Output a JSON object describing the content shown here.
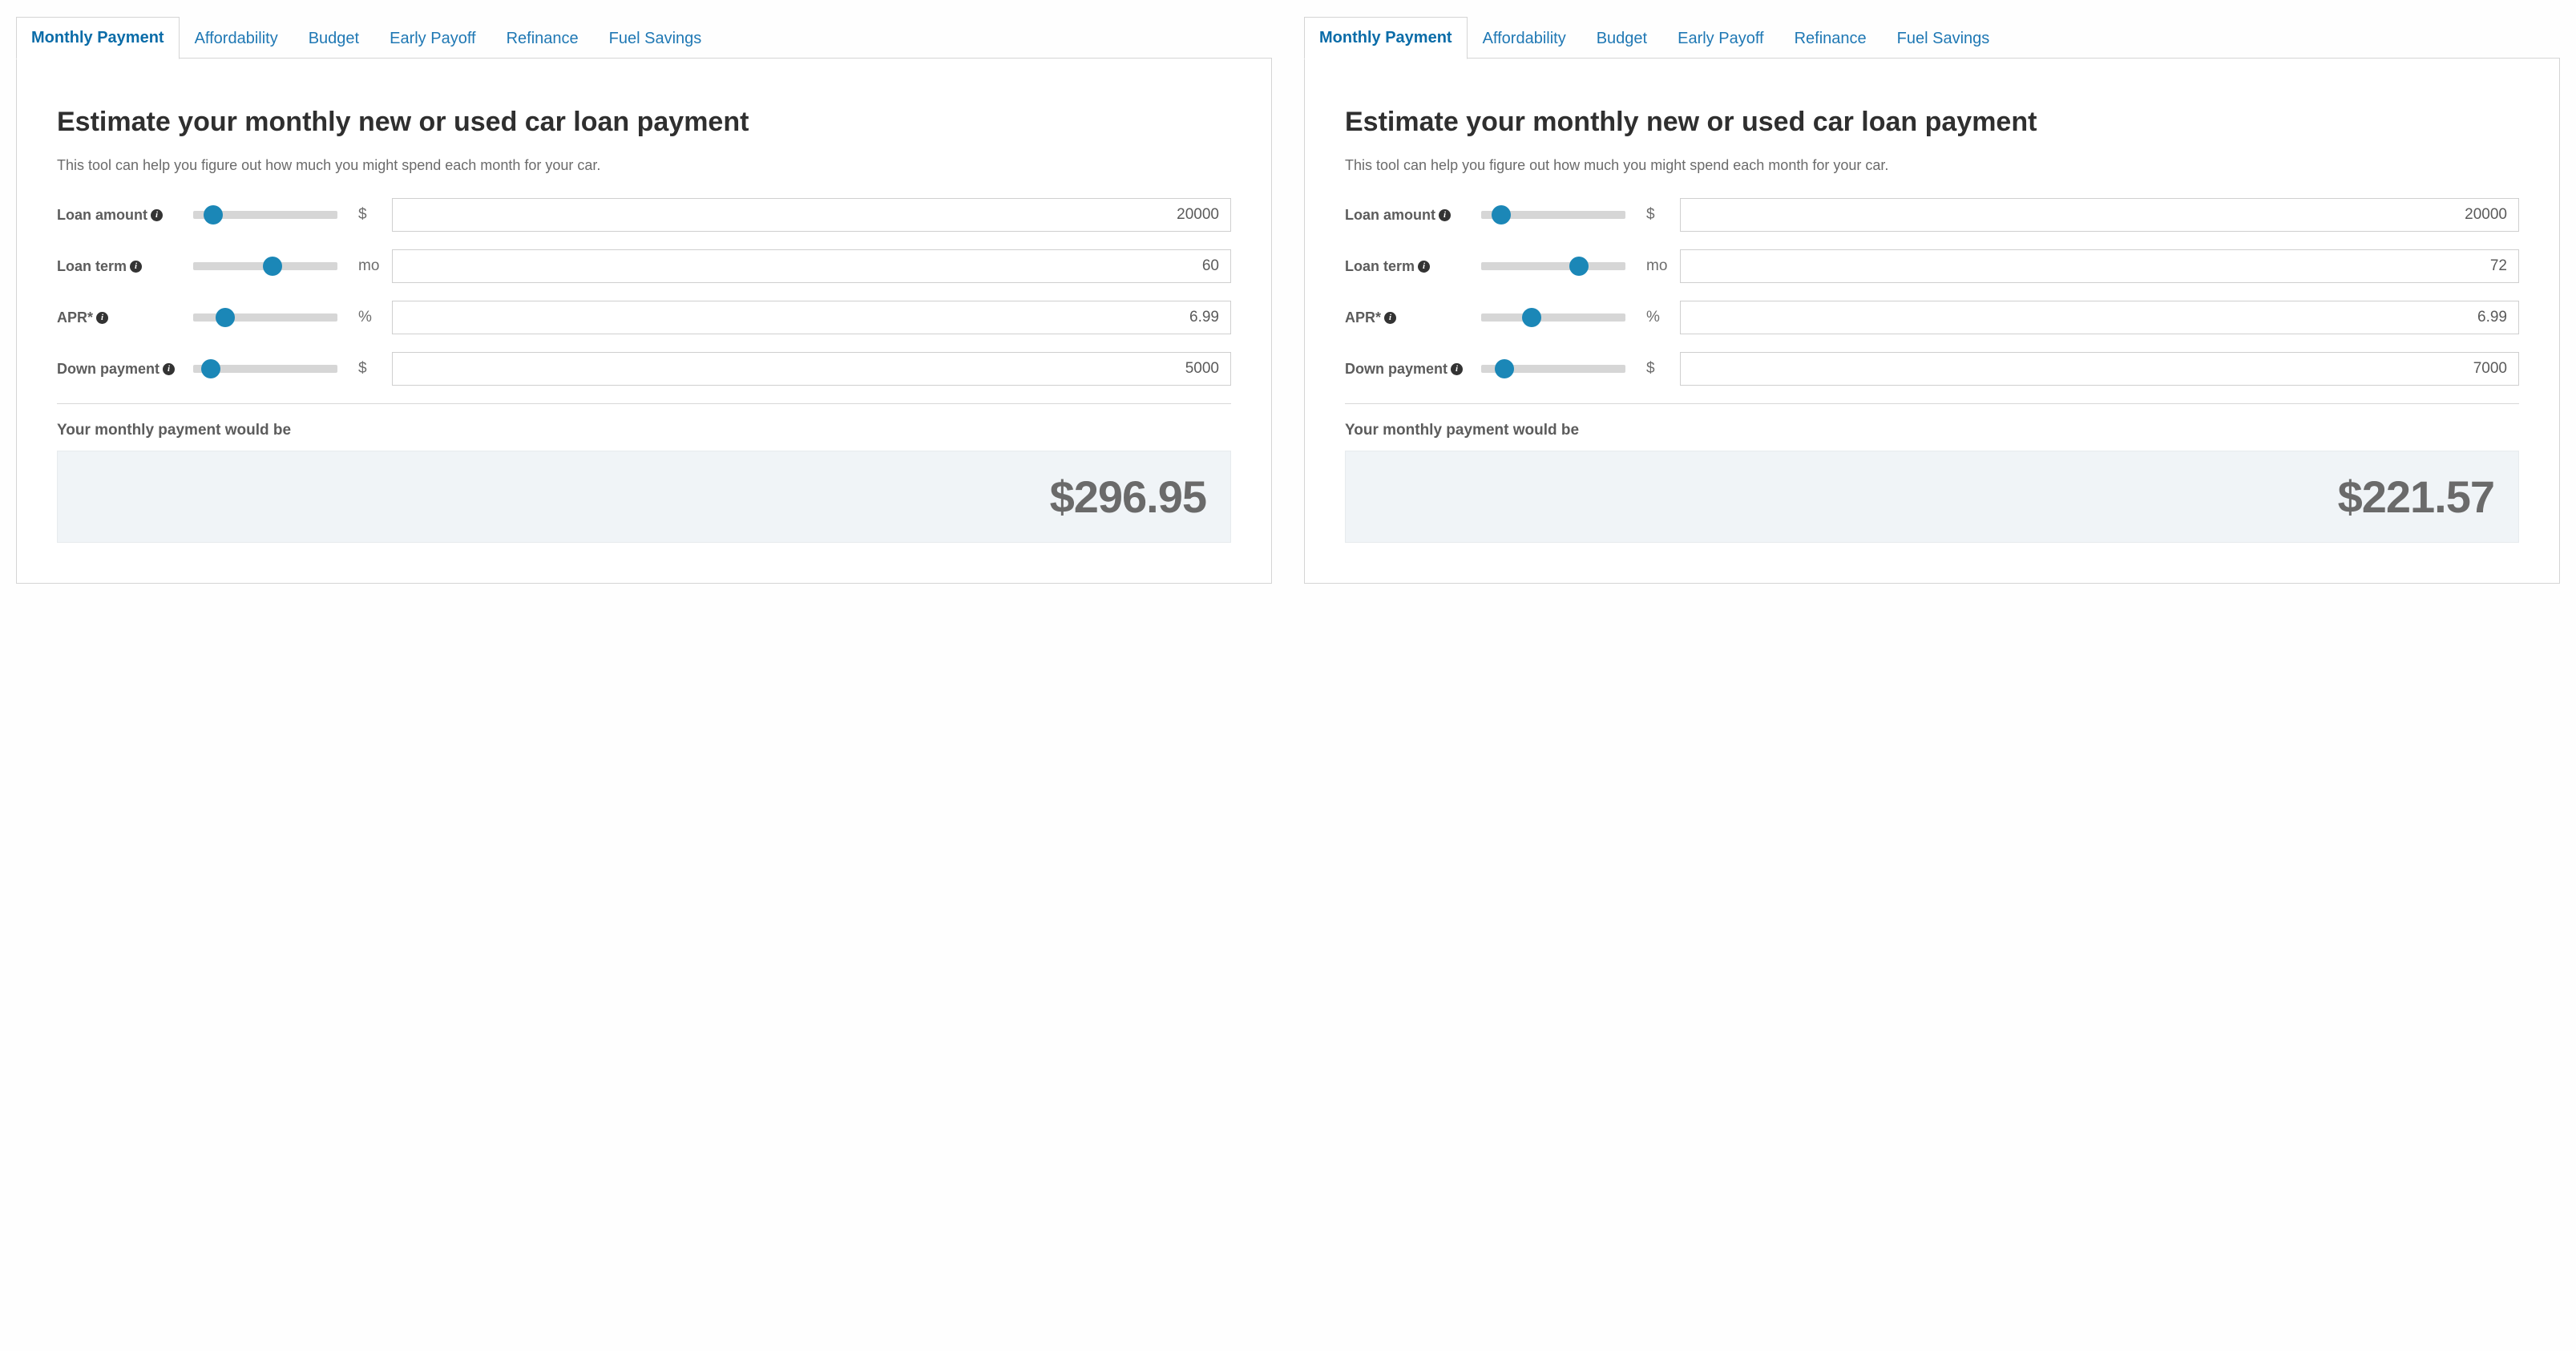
{
  "panels": [
    {
      "tabs": [
        {
          "label": "Monthly Payment",
          "active": true
        },
        {
          "label": "Affordability",
          "active": false
        },
        {
          "label": "Budget",
          "active": false
        },
        {
          "label": "Early Payoff",
          "active": false
        },
        {
          "label": "Refinance",
          "active": false
        },
        {
          "label": "Fuel Savings",
          "active": false
        }
      ],
      "heading": "Estimate your monthly new or used car loan payment",
      "subheading": "This tool can help you figure out how much you might spend each month for your car.",
      "rows": [
        {
          "label": "Loan amount",
          "unit": "$",
          "value": "20000",
          "slider_pct": 14
        },
        {
          "label": "Loan term",
          "unit": "mo",
          "value": "60",
          "slider_pct": 55
        },
        {
          "label": "APR*",
          "unit": "%",
          "value": "6.99",
          "slider_pct": 22
        },
        {
          "label": "Down payment",
          "unit": "$",
          "value": "5000",
          "slider_pct": 12
        }
      ],
      "result_label": "Your monthly payment would be",
      "result_value": "$296.95"
    },
    {
      "tabs": [
        {
          "label": "Monthly Payment",
          "active": true
        },
        {
          "label": "Affordability",
          "active": false
        },
        {
          "label": "Budget",
          "active": false
        },
        {
          "label": "Early Payoff",
          "active": false
        },
        {
          "label": "Refinance",
          "active": false
        },
        {
          "label": "Fuel Savings",
          "active": false
        }
      ],
      "heading": "Estimate your monthly new or used car loan payment",
      "subheading": "This tool can help you figure out how much you might spend each month for your car.",
      "rows": [
        {
          "label": "Loan amount",
          "unit": "$",
          "value": "20000",
          "slider_pct": 14
        },
        {
          "label": "Loan term",
          "unit": "mo",
          "value": "72",
          "slider_pct": 68
        },
        {
          "label": "APR*",
          "unit": "%",
          "value": "6.99",
          "slider_pct": 35
        },
        {
          "label": "Down payment",
          "unit": "$",
          "value": "7000",
          "slider_pct": 16
        }
      ],
      "result_label": "Your monthly payment would be",
      "result_value": "$221.57"
    }
  ]
}
